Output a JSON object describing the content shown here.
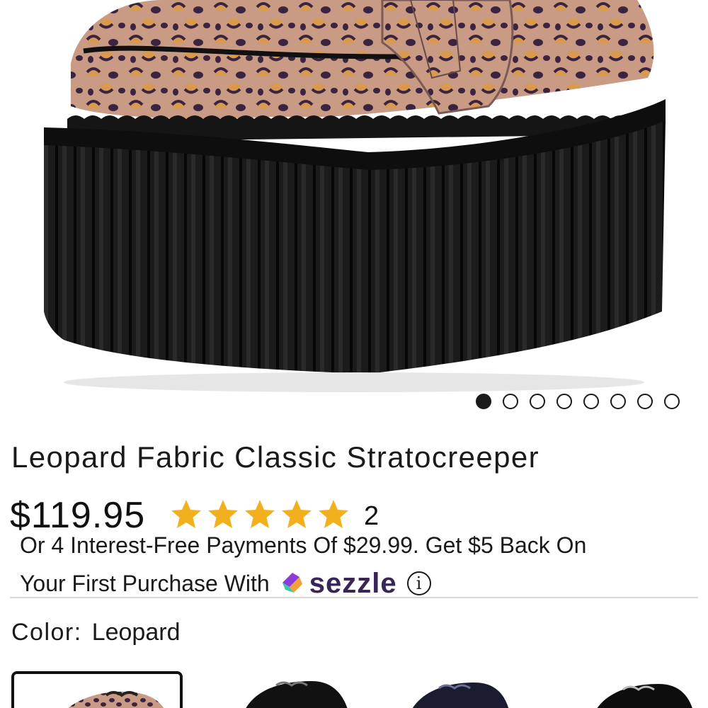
{
  "product": {
    "image_alt": "Leopard Fabric Classic Stratocreeper",
    "title": "Leopard Fabric Classic Stratocreeper",
    "price": "$119.95",
    "rating": 5,
    "rating_max": 5,
    "review_count": "2",
    "carousel": {
      "total": 8,
      "active": 1
    }
  },
  "payments": {
    "line1": "Or 4 Interest-Free Payments Of $29.99. Get $5 Back On",
    "line2": "Your First Purchase With",
    "provider": "sezzle",
    "info_symbol": "i"
  },
  "color": {
    "label": "Color:",
    "value": "Leopard",
    "swatches": [
      "Leopard",
      "Black",
      "Navy",
      "Black Suede"
    ],
    "selected": "Leopard"
  },
  "colors": {
    "star": "#f2b01e",
    "sezzle_text": "#392558",
    "platform": "#1b1b1b",
    "leopard_base": "#c99a84"
  }
}
